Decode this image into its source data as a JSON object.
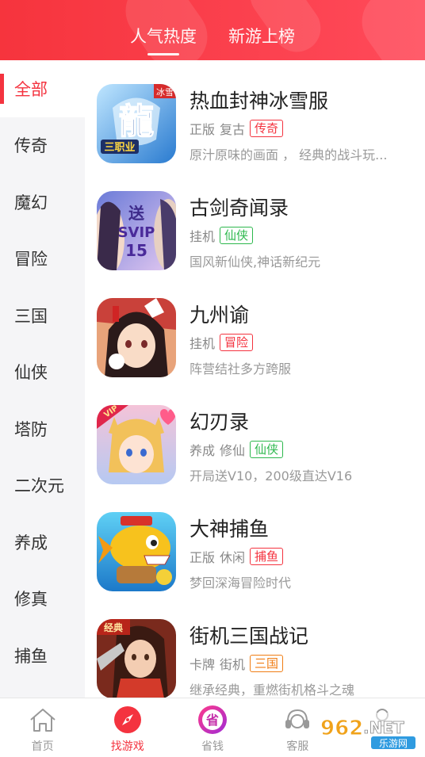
{
  "header": {
    "tabs": [
      {
        "label": "人气热度",
        "active": true
      },
      {
        "label": "新游上榜",
        "active": false
      }
    ]
  },
  "sidebar": {
    "items": [
      {
        "label": "全部",
        "active": true
      },
      {
        "label": "传奇"
      },
      {
        "label": "魔幻"
      },
      {
        "label": "冒险"
      },
      {
        "label": "三国"
      },
      {
        "label": "仙侠"
      },
      {
        "label": "塔防"
      },
      {
        "label": "二次元"
      },
      {
        "label": "养成"
      },
      {
        "label": "修真"
      },
      {
        "label": "捕鱼"
      }
    ]
  },
  "games": [
    {
      "name": "热血封神冰雪服",
      "tags": [
        "正版",
        "复古"
      ],
      "badge": "传奇",
      "badge_color": "red",
      "desc": "原汁原味的画面 ， 经典的战斗玩...",
      "icon": "game-icon-ice-dragon"
    },
    {
      "name": "古剑奇闻录",
      "tags": [
        "挂机"
      ],
      "badge": "仙侠",
      "badge_color": "green",
      "desc": "国风新仙侠,神话新纪元",
      "icon": "game-icon-svip"
    },
    {
      "name": "九州谕",
      "tags": [
        "挂机"
      ],
      "badge": "冒险",
      "badge_color": "red",
      "desc": "阵营结社多方跨服",
      "icon": "game-icon-fox-girl"
    },
    {
      "name": "幻刃录",
      "tags": [
        "养成",
        "修仙"
      ],
      "badge": "仙侠",
      "badge_color": "green",
      "desc": "开局送V10，200级直达V16",
      "icon": "game-icon-vip-girl"
    },
    {
      "name": "大神捕鱼",
      "tags": [
        "正版",
        "休闲"
      ],
      "badge": "捕鱼",
      "badge_color": "red",
      "desc": "梦回深海冒险时代",
      "icon": "game-icon-fish"
    },
    {
      "name": "街机三国战记",
      "tags": [
        "卡牌",
        "街机"
      ],
      "badge": "三国",
      "badge_color": "orange",
      "desc": "继承经典，重燃街机格斗之魂",
      "icon": "game-icon-classic"
    }
  ],
  "icon_texts": {
    "g1_corner": "冰雪",
    "g1_title": "三职业",
    "g2_line1": "送",
    "g2_line2": "SVIP",
    "g2_line3": "15",
    "g4_corner": "VIP",
    "g6_corner": "经典"
  },
  "bottom_nav": [
    {
      "label": "首页",
      "icon": "home-icon"
    },
    {
      "label": "找游戏",
      "icon": "compass-icon",
      "active": true
    },
    {
      "label": "省钱",
      "icon": "save-money-icon"
    },
    {
      "label": "客服",
      "icon": "headset-icon"
    },
    {
      "label": "",
      "icon": "user-icon"
    }
  ],
  "save_icon_char": "省",
  "watermark": {
    "number": "962",
    "domain": ".NET",
    "subtitle": "乐游网"
  },
  "colors": {
    "accent": "#f4333f",
    "green": "#2db84d",
    "orange": "#f07d14"
  }
}
